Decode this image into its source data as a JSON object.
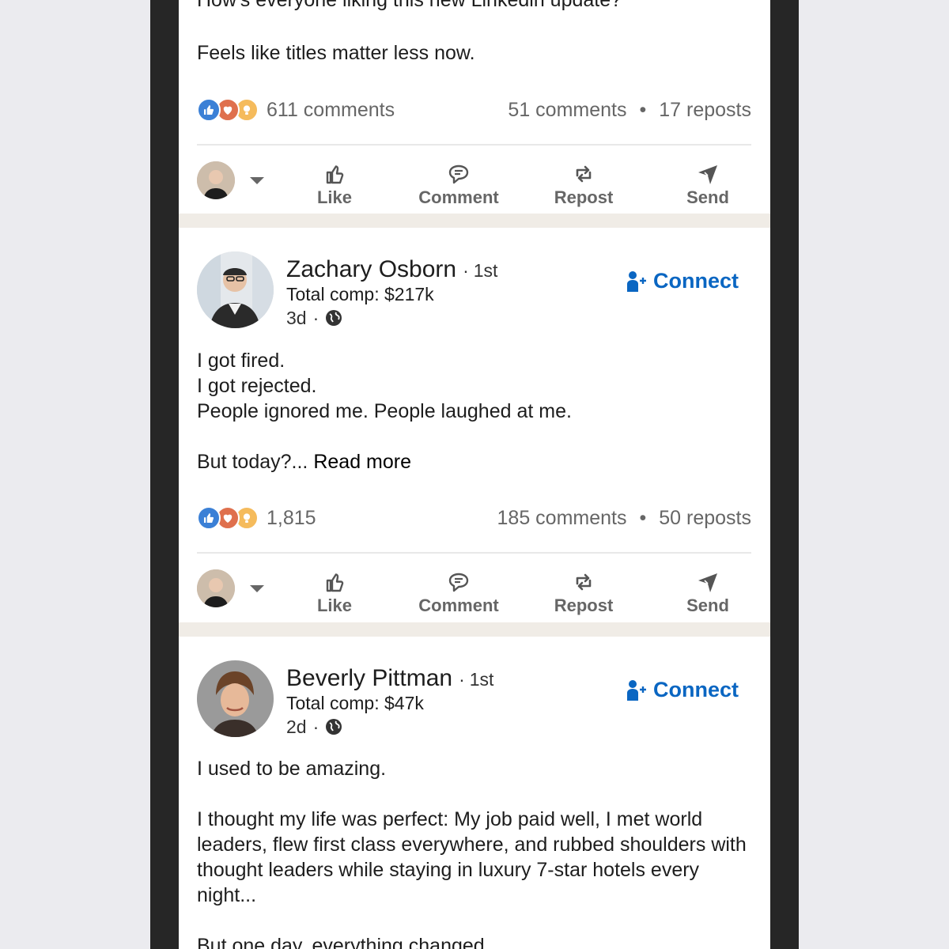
{
  "post1": {
    "text_partial": "How's everyone liking this new Linkedin update?",
    "text": "Feels like titles matter less now.",
    "reaction_count": "611 comments",
    "comments": "51 comments",
    "reposts": "17 reposts"
  },
  "post2": {
    "author_name": "Zachary Osborn",
    "degree": "1st",
    "subtitle": "Total comp: $217k",
    "time": "3d",
    "connect_label": "Connect",
    "text": "I got fired.\nI got rejected.\nPeople ignored me. People laughed at me.\n\nBut today?...",
    "read_more": "Read more",
    "reaction_count": "1,815",
    "comments": "185 comments",
    "reposts": "50 reposts"
  },
  "post3": {
    "author_name": "Beverly Pittman",
    "degree": "1st",
    "subtitle": "Total comp: $47k",
    "time": "2d",
    "connect_label": "Connect",
    "text": "I used to be amazing.\n\nI thought my life was perfect: My job paid well, I met world leaders, flew first class everywhere, and rubbed shoulders with thought leaders while staying in luxury 7-star hotels every night...\n\nBut one day, everything changed."
  },
  "actions": {
    "like": "Like",
    "comment": "Comment",
    "repost": "Repost",
    "send": "Send"
  },
  "separators": {
    "dot": "·",
    "stat_dot": "•"
  },
  "colors": {
    "link_blue": "#0a66c2",
    "like_blue": "#3b80d6",
    "love_red": "#df704d",
    "insight_yellow": "#f5bb5c",
    "feed_background": "#f0ece6",
    "phone_frame": "#262626",
    "page_background": "#ebebef"
  },
  "icons": [
    "like-reaction-icon",
    "love-reaction-icon",
    "insightful-reaction-icon",
    "thumbs-up-icon",
    "comment-icon",
    "repost-icon",
    "send-icon",
    "globe-icon",
    "add-person-icon",
    "chevron-down-icon"
  ]
}
